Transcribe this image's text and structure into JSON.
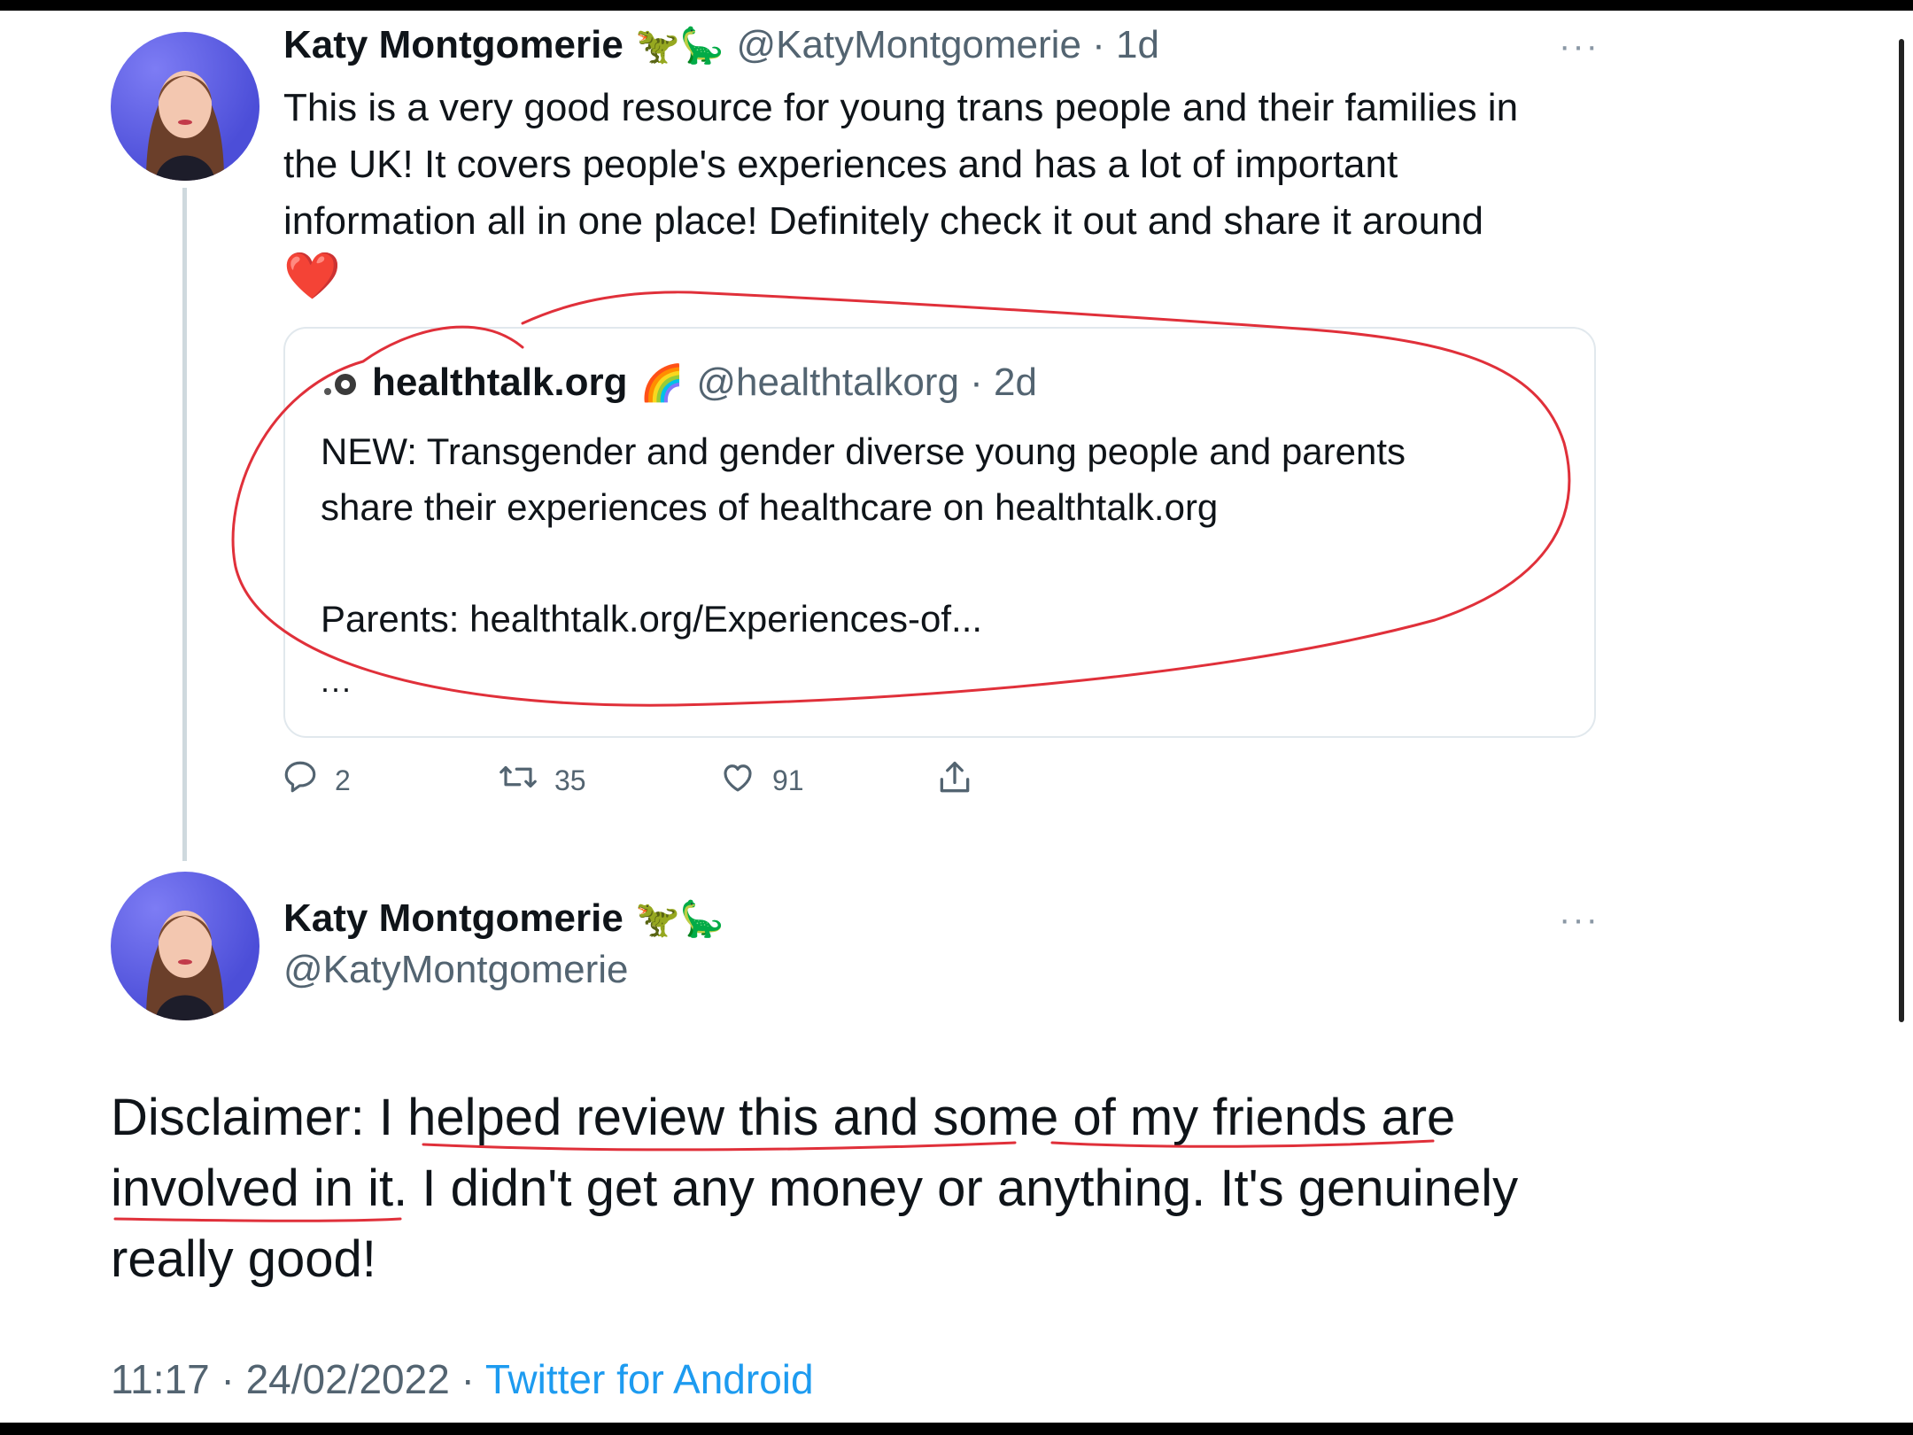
{
  "tweet1": {
    "name": "Katy Montgomerie",
    "emojis": "🦖🦕",
    "handle_time": "@KatyMontgomerie · 1d",
    "more": "···",
    "text_line1": "This is a very good resource for young trans people and their families in",
    "text_line2": "the UK! It covers people's experiences and has a lot of important",
    "text_line3": "information all in one place! Definitely check it out and share it around",
    "heart": "❤️"
  },
  "quoted": {
    "name": "healthtalk.org",
    "emoji": "🌈",
    "handle_time": "@healthtalkorg · 2d",
    "line1": "NEW: Transgender and gender diverse young people and parents",
    "line2": "share their experiences of healthcare on healthtalk.org",
    "line3": "Parents: healthtalk.org/Experiences-of...",
    "ellipsis": "..."
  },
  "actions": {
    "replies": "2",
    "retweets": "35",
    "likes": "91",
    "reply_icon": "reply-icon",
    "retweet_icon": "retweet-icon",
    "like_icon": "heart-icon",
    "share_icon": "share-icon"
  },
  "tweet2": {
    "name": "Katy Montgomerie",
    "emojis": "🦖🦕",
    "handle": "@KatyMontgomerie",
    "more": "···",
    "text_line1": "Disclaimer: I helped review this and some of my friends are",
    "text_line2": "involved in it. I didn't get any money or anything. It's genuinely",
    "text_line3": "really good!",
    "time_date": "11:17 · 24/02/2022 · ",
    "source": "Twitter for Android"
  },
  "colors": {
    "accent": "#1d9bf0",
    "annotation": "#e0303a",
    "secondary_text": "#536471"
  }
}
